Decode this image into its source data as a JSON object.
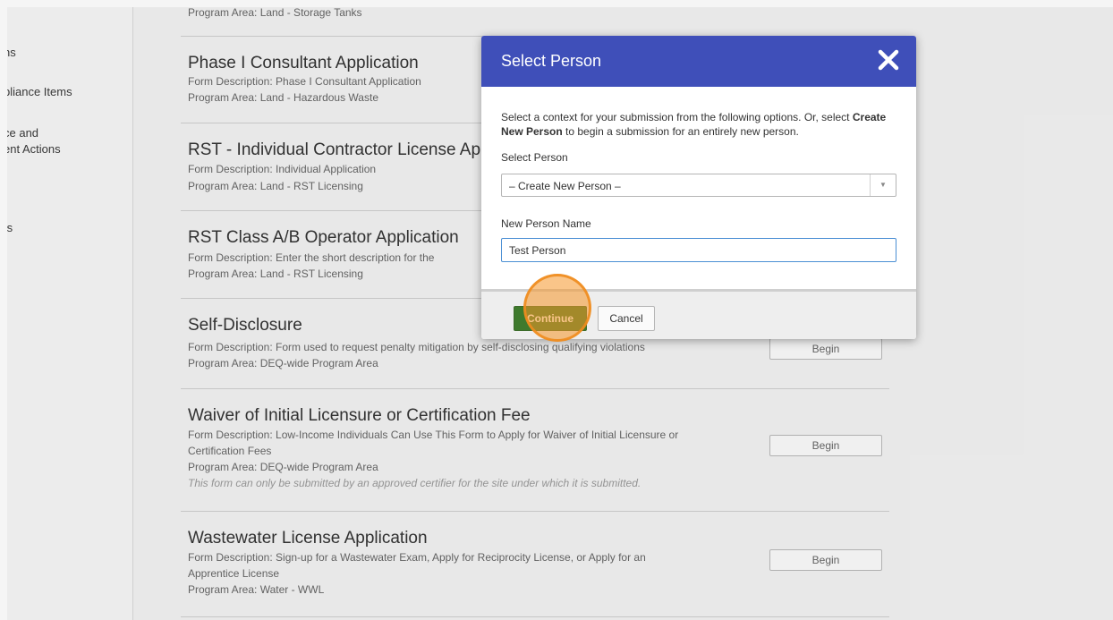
{
  "sidebar": {
    "items": [
      {
        "label": "ns"
      },
      {
        "label": "pliance Items"
      },
      {
        "label": "ce and"
      },
      {
        "label": "ent Actions"
      },
      {
        "label": "ts"
      }
    ]
  },
  "forms": [
    {
      "area": "Program Area: Land - Storage Tanks"
    },
    {
      "title": "Phase I Consultant Application",
      "desc": "Form Description: Phase I Consultant Application",
      "area": "Program Area: Land - Hazardous Waste"
    },
    {
      "title": "RST - Individual Contractor License Ap",
      "desc": "Form Description: Individual Application",
      "area": "Program Area: Land - RST Licensing"
    },
    {
      "title": "RST Class A/B Operator Application",
      "desc": "Form Description: Enter the short description for the",
      "area": "Program Area: Land - RST Licensing"
    },
    {
      "title": "Self-Disclosure",
      "desc": "Form Description: Form used to request penalty mitigation by self-disclosing qualifying violations",
      "area": "Program Area: DEQ-wide Program Area",
      "button": "Begin"
    },
    {
      "title": "Waiver of Initial Licensure or Certification Fee",
      "desc": "Form Description: Low-Income Individuals Can Use This Form to Apply for Waiver of Initial Licensure or",
      "desc2": "Certification Fees",
      "area": "Program Area: DEQ-wide Program Area",
      "note": "This form can only be submitted by an approved certifier for the site under which it is submitted.",
      "button": "Begin"
    },
    {
      "title": "Wastewater License Application",
      "desc": "Form Description: Sign-up for a Wastewater Exam, Apply for Reciprocity License, or Apply for an",
      "desc2": "Apprentice License",
      "area": "Program Area: Water - WWL",
      "button": "Begin"
    }
  ],
  "modal": {
    "title": "Select Person",
    "close_icon": "close-icon",
    "desc_part1": "Select a context for your submission from the following options. Or, select ",
    "desc_bold": "Create New Person",
    "desc_part2": " to begin a submission for an entirely new person.",
    "select_label": "Select Person",
    "select_value": "– Create New Person –",
    "name_label": "New Person Name",
    "name_value": "Test Person",
    "continue_label": "Continue",
    "cancel_label": "Cancel"
  },
  "colors": {
    "header": "#3f4fb9",
    "continue": "#3e7a2d",
    "click_highlight": "#f5962a"
  }
}
